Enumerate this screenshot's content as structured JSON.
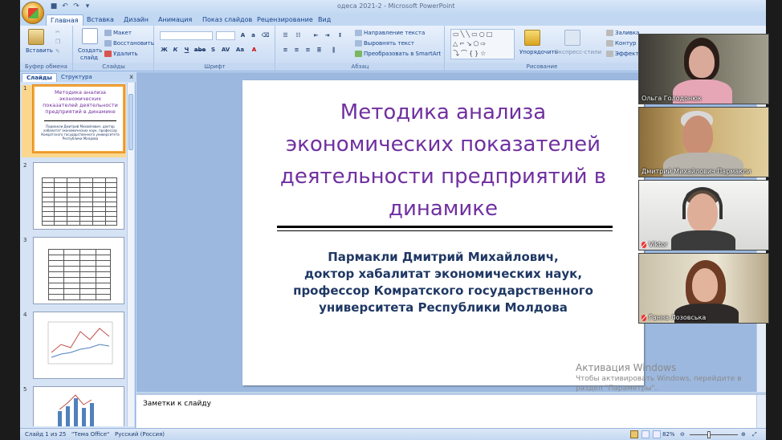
{
  "window": {
    "title": "одеса 2021-2 - Microsoft PowerPoint",
    "minimize": "–",
    "maximize": "□",
    "close": "✕"
  },
  "qat": {
    "save": "■",
    "undo": "↶",
    "redo": "↷",
    "more": "▾"
  },
  "tabs": [
    "Главная",
    "Вставка",
    "Дизайн",
    "Анимация",
    "Показ слайдов",
    "Рецензирование",
    "Вид"
  ],
  "ribbon": {
    "clipboard": {
      "label": "Буфер обмена",
      "paste": "Вставить"
    },
    "slides": {
      "label": "Слайды",
      "new_slide": "Создать",
      "new_slide2": "слайд",
      "layout": "Макет",
      "reset": "Восстановить",
      "delete": "Удалить"
    },
    "font": {
      "label": "Шрифт",
      "buttons": [
        "Ж",
        "К",
        "Ч",
        "abe",
        "S",
        "AV",
        "Aa",
        "A"
      ]
    },
    "paragraph": {
      "label": "Абзац",
      "text_direction": "Направление текста",
      "align_text": "Выровнять текст",
      "smartart": "Преобразовать в SmartArt"
    },
    "drawing": {
      "label": "Рисование",
      "arrange": "Упорядочить",
      "quick_styles": "Экспресс-стили",
      "fill": "Заливка",
      "outline": "Контур",
      "effects": "Эффекты"
    }
  },
  "pane": {
    "tabs": [
      "Слайды",
      "Структура"
    ],
    "close": "x",
    "slide_numbers": [
      "1",
      "2",
      "3",
      "4",
      "5"
    ],
    "thumb1_title": "Методика анализа экономических показателей деятельности предприятий в динамике",
    "thumb1_author": "Пармакли Дмитрий Михайлович, доктор хабалитат экономических наук, профессор Комратского государственного университета Республики Молдова"
  },
  "slide": {
    "title": "Методика  анализа экономических показателей деятельности предприятий в динамике",
    "author_lines": [
      "Пармакли Дмитрий Михайлович,",
      "доктор хабалитат экономических наук,",
      "профессор  Комратского государственного",
      "университета  Республики Молдова"
    ]
  },
  "notes": {
    "placeholder": "Заметки к слайду"
  },
  "status": {
    "slide_counter": "Слайд 1 из 25",
    "theme": "\"Тема Office\"",
    "language": "Русский (Россия)",
    "zoom": "82%"
  },
  "watermark": {
    "line1": "Активация Windows",
    "line2": "Чтобы активировать Windows, перейдите в",
    "line3": "раздел \"Параметры\"."
  },
  "participants": [
    {
      "name": "Ольга Голодонюк",
      "muted": false
    },
    {
      "name": "Дмитрий Михайлович Пармакли",
      "muted": false
    },
    {
      "name": "Viktor",
      "muted": true
    },
    {
      "name": "Ганна  Лозовська",
      "muted": true
    }
  ],
  "colors": {
    "title_purple": "#7030a0",
    "author_navy": "#1f3864",
    "ribbon_blue": "#c2d8f2",
    "selected_thumb": "#f2a73b"
  }
}
